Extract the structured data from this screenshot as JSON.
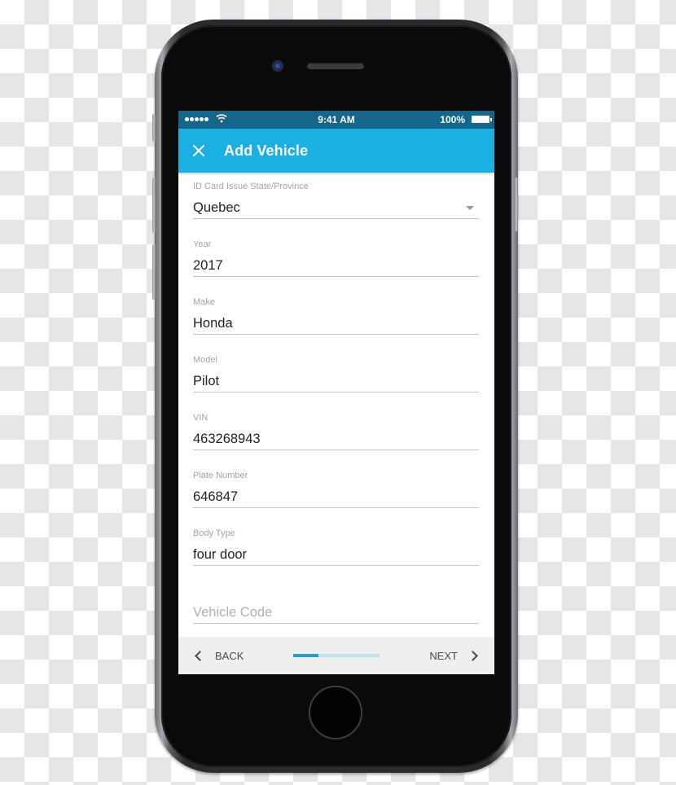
{
  "status_bar": {
    "time": "9:41 AM",
    "battery": "100%",
    "signal_icon": "signal-dots-icon",
    "wifi_icon": "wifi-icon",
    "battery_icon": "battery-icon"
  },
  "app_bar": {
    "title": "Add Vehicle",
    "close_icon": "close-icon"
  },
  "form": {
    "fields": [
      {
        "label": "ID Card Issue State/Province",
        "value": "Quebec",
        "type": "select"
      },
      {
        "label": "Year",
        "value": "2017"
      },
      {
        "label": "Make",
        "value": "Honda"
      },
      {
        "label": "Model",
        "value": "Pilot"
      },
      {
        "label": "VIN",
        "value": "463268943"
      },
      {
        "label": "Plate Number",
        "value": "646847"
      },
      {
        "label": "Body Type",
        "value": "four door"
      },
      {
        "label": "",
        "value": "",
        "placeholder": "Vehicle Code"
      }
    ]
  },
  "bottom_bar": {
    "back_label": "BACK",
    "next_label": "NEXT",
    "progress_fraction": 0.29
  },
  "colors": {
    "status_bar": "#14678a",
    "app_bar": "#1ab0e3",
    "progress_fill": "#1f9fd3",
    "progress_track": "#c0e1ee"
  }
}
